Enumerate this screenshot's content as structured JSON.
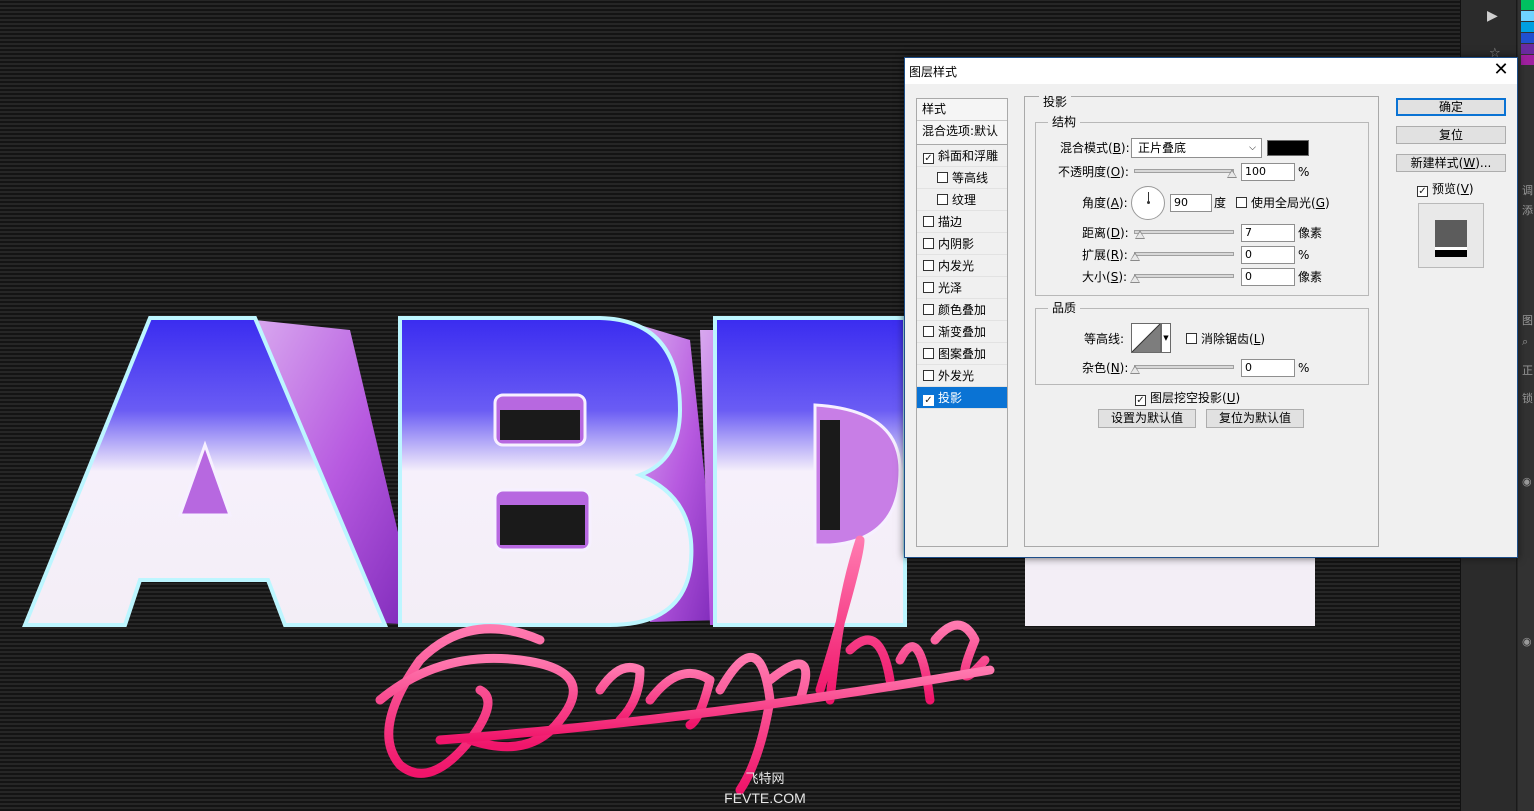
{
  "canvas": {
    "artwork_letters": "ABD",
    "artwork_script": "Graphics",
    "watermark_cn": "飞特网",
    "watermark_en": "FEVTE.COM"
  },
  "dialog": {
    "title": "图层样式",
    "close_glyph": "✕",
    "style_list": {
      "header": "样式",
      "blend_options": "混合选项:默认",
      "items": [
        {
          "label": "斜面和浮雕",
          "checked": "✓",
          "indent": false
        },
        {
          "label": "等高线",
          "checked": "",
          "indent": true
        },
        {
          "label": "纹理",
          "checked": "",
          "indent": true
        },
        {
          "label": "描边",
          "checked": "",
          "indent": false
        },
        {
          "label": "内阴影",
          "checked": "",
          "indent": false
        },
        {
          "label": "内发光",
          "checked": "",
          "indent": false
        },
        {
          "label": "光泽",
          "checked": "",
          "indent": false
        },
        {
          "label": "颜色叠加",
          "checked": "",
          "indent": false
        },
        {
          "label": "渐变叠加",
          "checked": "",
          "indent": false
        },
        {
          "label": "图案叠加",
          "checked": "",
          "indent": false
        },
        {
          "label": "外发光",
          "checked": "",
          "indent": false
        },
        {
          "label": "投影",
          "checked": "✓",
          "indent": false,
          "active": true
        }
      ]
    },
    "section_title": "投影",
    "structure": {
      "title": "结构",
      "blend_mode_label": "混合模式(",
      "blend_mode_key": "B",
      "blend_mode_value": "正片叠底",
      "shadow_color": "#000000",
      "opacity_label": "不透明度(",
      "opacity_key": "O",
      "opacity_value": "100",
      "opacity_unit": "%",
      "angle_label": "角度(",
      "angle_key": "A",
      "angle_value": "90",
      "angle_unit": "度",
      "global_light_label": "使用全局光(",
      "global_light_key": "G",
      "distance_label": "距离(",
      "distance_key": "D",
      "distance_value": "7",
      "distance_unit": "像素",
      "spread_label": "扩展(",
      "spread_key": "R",
      "spread_value": "0",
      "spread_unit": "%",
      "size_label": "大小(",
      "size_key": "S",
      "size_value": "0",
      "size_unit": "像素",
      "close_paren": "):"
    },
    "quality": {
      "title": "品质",
      "contour_label": "等高线:",
      "anti_alias_label": "消除锯齿(",
      "anti_alias_key": "L",
      "noise_label": "杂色(",
      "noise_key": "N",
      "noise_value": "0",
      "noise_unit": "%"
    },
    "knockout_label": "图层挖空投影(",
    "knockout_key": "U",
    "knockout_checked": "✓",
    "set_default_label": "设置为默认值",
    "reset_default_label": "复位为默认值",
    "ok_label": "确定",
    "reset_label": "复位",
    "new_style_label": "新建样式(",
    "new_style_key": "W",
    "new_style_suffix": ")...",
    "preview_label": "预览(",
    "preview_key": "V",
    "preview_checked": "✓",
    "paren_close": ")"
  },
  "right_panel": {
    "play_icon": "▶",
    "star_icon": "☆",
    "glyphs": [
      "调",
      "添",
      "图",
      "⌕",
      "正",
      "锁",
      "◉",
      "◉"
    ]
  }
}
